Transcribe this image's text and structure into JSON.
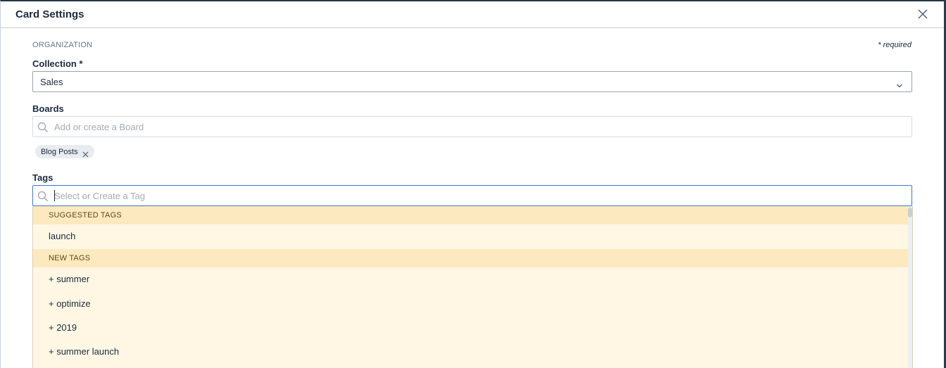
{
  "modal": {
    "title": "Card Settings",
    "close_icon": "close-icon"
  },
  "organization": {
    "section_label": "ORGANIZATION",
    "required_note": "* required"
  },
  "collection": {
    "label": "Collection *",
    "value": "Sales",
    "icon": "chevron-down-icon"
  },
  "boards": {
    "label": "Boards",
    "placeholder": "Add or create a Board",
    "chips": [
      {
        "label": "Blog Posts"
      }
    ]
  },
  "tags": {
    "label": "Tags",
    "placeholder": "Select or Create a Tag",
    "value": "",
    "dropdown": {
      "suggested_header": "SUGGESTED TAGS",
      "suggested": [
        "launch"
      ],
      "new_header": "NEW TAGS",
      "new": [
        "+ summer",
        "+ optimize",
        "+ 2019",
        "+ summer launch"
      ]
    }
  },
  "colors": {
    "header_border": "#23364a",
    "focus_border": "#3d78c9",
    "dropdown_bg": "#fff7e4",
    "dropdown_header_bg": "#fce9c0"
  }
}
